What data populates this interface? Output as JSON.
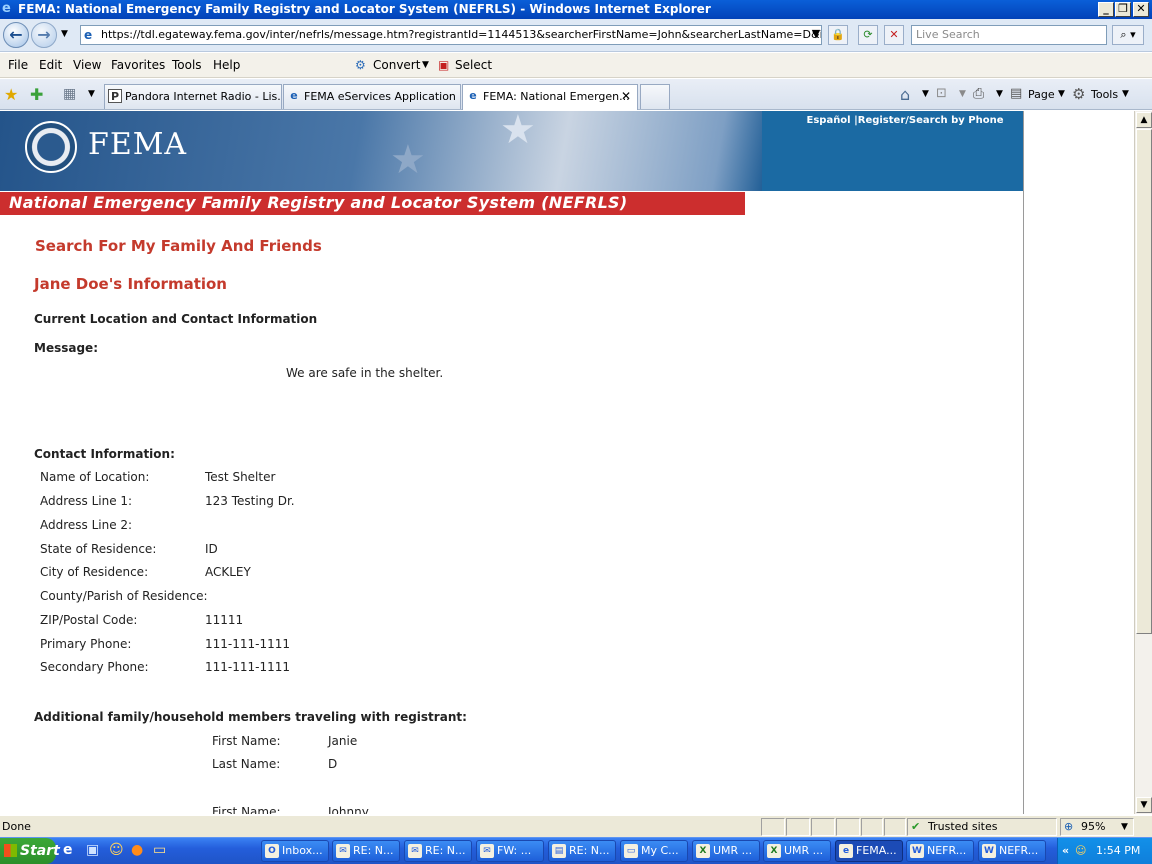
{
  "window": {
    "title": "FEMA: National Emergency Family Registry and Locator System (NEFRLS) - Windows Internet Explorer"
  },
  "address": {
    "url": "https://tdl.egateway.fema.gov/inter/nefrls/message.htm?registrantId=1144513&searcherFirstName=John&searcherLastName=D&isSuperUser=f",
    "search_placeholder": "Live Search"
  },
  "menu": {
    "items": [
      "File",
      "Edit",
      "View",
      "Favorites",
      "Tools",
      "Help"
    ],
    "convert": "Convert",
    "select": "Select"
  },
  "tabs": [
    {
      "label": "Pandora Internet Radio - Lis..."
    },
    {
      "label": "FEMA eServices Application ..."
    },
    {
      "label": "FEMA: National Emergen..."
    }
  ],
  "cmdbar": {
    "page": "Page",
    "tools": "Tools"
  },
  "banner": {
    "logo": "FEMA",
    "links": "Español |Register/Search by Phone",
    "system_title": "National Emergency Family Registry and Locator System  (NEFRLS)"
  },
  "page": {
    "heading": "Search For My Family And Friends",
    "person_heading": "Jane Doe's Information",
    "section_current": "Current Location and Contact Information",
    "message_label": "Message:",
    "message_text": "We are safe in the shelter.",
    "contact_label": "Contact Information:",
    "contact": [
      {
        "label": "Name of Location:",
        "value": "Test Shelter"
      },
      {
        "label": "Address Line 1:",
        "value": "123 Testing Dr."
      },
      {
        "label": "Address Line 2:",
        "value": ""
      },
      {
        "label": "State of Residence:",
        "value": "ID"
      },
      {
        "label": "City of Residence:",
        "value": "ACKLEY"
      },
      {
        "label": "County/Parish of Residence:",
        "value": ""
      },
      {
        "label": "ZIP/Postal Code:",
        "value": "11111"
      },
      {
        "label": "Primary Phone:",
        "value": "111-111-1111"
      },
      {
        "label": "Secondary Phone:",
        "value": "111-111-1111"
      }
    ],
    "members_label": "Additional family/household members traveling with registrant:",
    "members": [
      {
        "first_label": "First Name:",
        "first": "Janie",
        "last_label": "Last Name:",
        "last": "D"
      },
      {
        "first_label": "First Name:",
        "first": "Johnny"
      }
    ]
  },
  "status": {
    "text": "Done",
    "zone": "Trusted sites",
    "zoom": "95%"
  },
  "taskbar": {
    "start": "Start",
    "tasks": [
      "Inbox...",
      "RE: N...",
      "RE: N...",
      "FW: ...",
      "RE: N...",
      "My C...",
      "UMR ...",
      "UMR ...",
      "FEMA...",
      "NEFR...",
      "NEFR..."
    ],
    "clock": "1:54 PM"
  }
}
